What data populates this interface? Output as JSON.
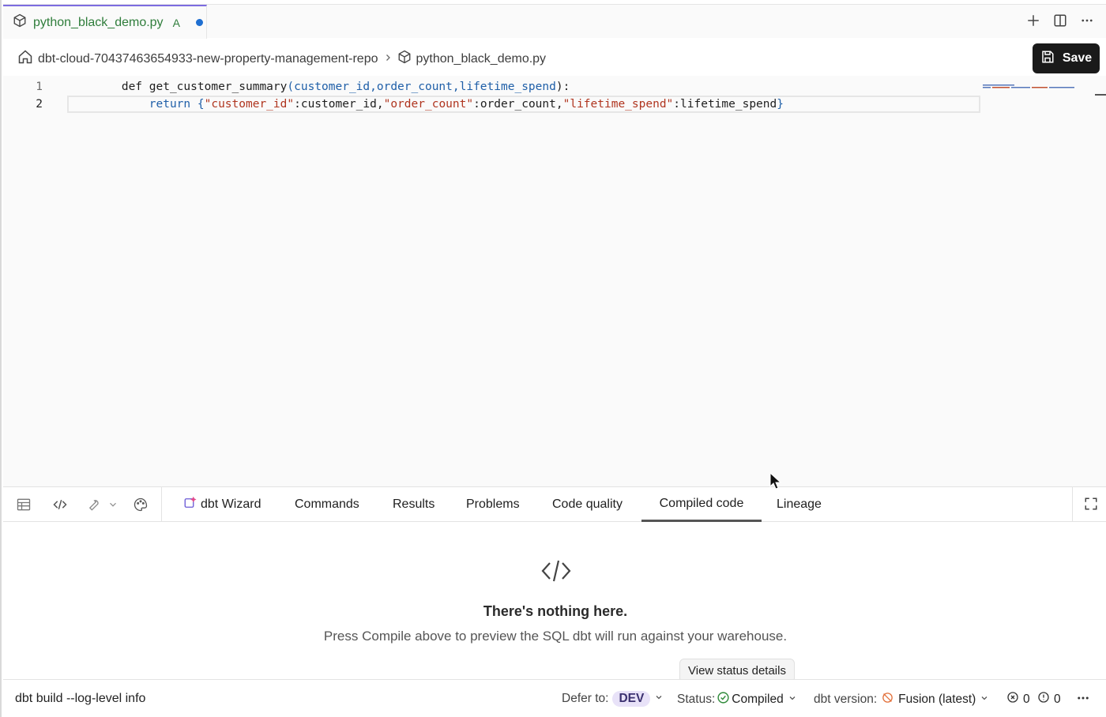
{
  "tab": {
    "filename": "python_black_demo.py",
    "git_status": "A"
  },
  "breadcrumb": {
    "repo": "dbt-cloud-70437463654933-new-property-management-repo",
    "file": "python_black_demo.py"
  },
  "save_label": "Save",
  "editor": {
    "line_numbers": [
      "1",
      "2"
    ],
    "line1": {
      "def": "def ",
      "fn": "get_customer_summary",
      "open": "(",
      "params": "customer_id,order_count,lifetime_spend",
      "close": "):"
    },
    "line2": {
      "indent": "    ",
      "ret": "return ",
      "lb": "{",
      "k1": "\"customer_id\"",
      "v1": ":customer_id,",
      "k2": "\"order_count\"",
      "v2": ":order_count,",
      "k3": "\"lifetime_spend\"",
      "v3": ":lifetime_spend",
      "rb": "}"
    }
  },
  "panel": {
    "tabs": [
      "dbt Wizard",
      "Commands",
      "Results",
      "Problems",
      "Code quality",
      "Compiled code",
      "Lineage"
    ],
    "active_tab": "Compiled code"
  },
  "empty_state": {
    "title": "There's nothing here.",
    "subtitle": "Press Compile above to preview the SQL dbt will run against your warehouse."
  },
  "tooltip": "View status details",
  "status_bar": {
    "command": "dbt build --log-level info",
    "defer_label": "Defer to:",
    "defer_value": "DEV",
    "status_label": "Status:",
    "status_value": "Compiled",
    "version_label": "dbt version:",
    "version_value": "Fusion (latest)",
    "errors": "0",
    "warnings": "0"
  }
}
